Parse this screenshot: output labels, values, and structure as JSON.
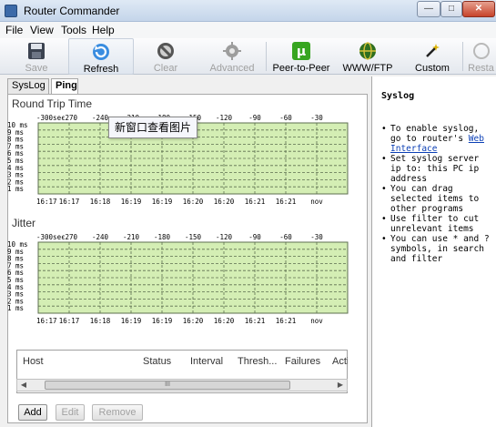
{
  "window": {
    "title": "Router Commander",
    "min": "—",
    "max": "□",
    "close": "✕"
  },
  "menu": [
    "File",
    "View",
    "Tools",
    "Help"
  ],
  "toolbar": [
    {
      "label": "Save",
      "icon": "floppy-icon",
      "enabled": false
    },
    {
      "label": "Refresh",
      "icon": "refresh-icon",
      "enabled": true
    },
    {
      "label": "Clear",
      "icon": "no-entry-icon",
      "enabled": false
    },
    {
      "label": "Advanced",
      "icon": "gear-icon",
      "enabled": false
    },
    {
      "label": "Peer-to-Peer",
      "icon": "utorrent-icon",
      "enabled": true
    },
    {
      "label": "WWW/FTP",
      "icon": "globe-icon",
      "enabled": true
    },
    {
      "label": "Custom",
      "icon": "wand-icon",
      "enabled": true
    },
    {
      "label": "Resta",
      "icon": "restart-icon",
      "enabled": false
    }
  ],
  "tabs": [
    "SysLog",
    "Ping"
  ],
  "active_tab": "Ping",
  "tooltip": "新窗口查看图片",
  "charts": [
    {
      "title": "Round Trip Time",
      "y_ticks": [
        "10 ms",
        "9 ms",
        "8 ms",
        "7 ms",
        "6 ms",
        "5 ms",
        "4 ms",
        "3 ms",
        "2 ms",
        "1 ms"
      ],
      "top_ticks": [
        "-300sec",
        "-270",
        "-240",
        "-210",
        "-180",
        "-150",
        "-120",
        "-90",
        "-60",
        "-30"
      ],
      "bottom_ticks": [
        "16:17",
        "16:17",
        "16:18",
        "16:19",
        "16:19",
        "16:20",
        "16:20",
        "16:21",
        "16:21",
        "nov"
      ]
    },
    {
      "title": "Jitter",
      "y_ticks": [
        "10 ms",
        "9 ms",
        "8 ms",
        "7 ms",
        "6 ms",
        "5 ms",
        "4 ms",
        "3 ms",
        "2 ms",
        "1 ms"
      ],
      "top_ticks": [
        "-300sec",
        "-270",
        "-240",
        "-210",
        "-180",
        "-150",
        "-120",
        "-90",
        "-60",
        "-30"
      ],
      "bottom_ticks": [
        "16:17",
        "16:17",
        "16:18",
        "16:19",
        "16:19",
        "16:20",
        "16:20",
        "16:21",
        "16:21",
        "nov"
      ]
    }
  ],
  "host_table": {
    "columns": [
      "Host",
      "Status",
      "Interval",
      "Thresh...",
      "Failures",
      "Action"
    ],
    "scroll_mid": "III"
  },
  "buttons": [
    {
      "label": "Add",
      "enabled": true
    },
    {
      "label": "Edit",
      "enabled": false
    },
    {
      "label": "Remove",
      "enabled": false
    }
  ],
  "syslog_panel": {
    "title": "Syslog",
    "tip1_pre": "To enable syslog, go to router's ",
    "tip1_link": "Web Interface",
    "tips": [
      "Set syslog server ip to: this PC ip address",
      "You can drag selected items to other programs",
      "Use filter to cut unrelevant items",
      "You can use * and ? symbols, in search and filter"
    ]
  },
  "colors": {
    "plot_bg": "#d4eeb4",
    "grid": "#5d6f4f",
    "link": "#0b3fb5"
  }
}
